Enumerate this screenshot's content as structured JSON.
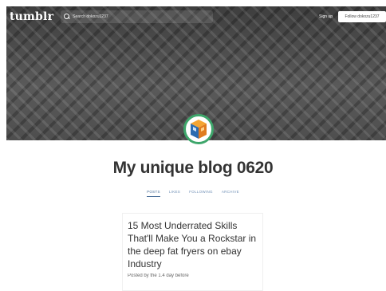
{
  "topbar": {
    "logo": "tumblr",
    "search_placeholder": "Search dokozu1237",
    "signup_label": "Sign up",
    "follow_label": "Follow dokozu1237"
  },
  "blog": {
    "title": "My unique blog 0620"
  },
  "tabs": [
    {
      "label": "POSTS",
      "active": true
    },
    {
      "label": "LIKES",
      "active": false
    },
    {
      "label": "FOLLOWING",
      "active": false
    },
    {
      "label": "ARCHIVE",
      "active": false
    }
  ],
  "post": {
    "title": "15 Most Underrated Skills That'll Make You a Rockstar in the deep fat fryers on ebay Industry",
    "byline": "Posted by the 1.4 day before"
  },
  "colors": {
    "accent_green": "#3ea66b",
    "tab_blue": "#6f8fb6"
  }
}
